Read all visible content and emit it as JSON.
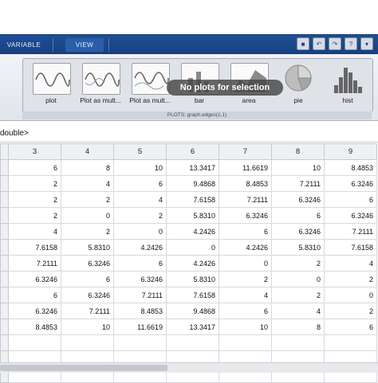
{
  "tabs": {
    "variable": "VARIABLE",
    "view": "VIEW"
  },
  "quick_access": [
    "save-icon",
    "undo-icon",
    "redo-icon",
    "help-icon",
    "menu-icon"
  ],
  "gallery": {
    "items": [
      {
        "label": "plot",
        "icon": "plot-icon"
      },
      {
        "label": "Plot as mult...",
        "icon": "plot-as-multiple-series-icon"
      },
      {
        "label": "Plot as mult...",
        "icon": "plot-as-multiple-series-icon"
      },
      {
        "label": "bar",
        "icon": "bar-icon"
      },
      {
        "label": "area",
        "icon": "area-icon"
      },
      {
        "label": "pie",
        "icon": "pie-icon"
      },
      {
        "label": "hist",
        "icon": "hist-icon"
      }
    ],
    "overlay": "No plots for selection",
    "caption": "PLOTS: graph.edges(1,1)"
  },
  "typebar": "double>",
  "table": {
    "columns": [
      "",
      "3",
      "4",
      "5",
      "6",
      "7",
      "8",
      "9"
    ],
    "rows": [
      [
        "",
        "6",
        "8",
        "10",
        "13.3417",
        "11.6619",
        "10",
        "8.4853"
      ],
      [
        "",
        "2",
        "4",
        "6",
        "9.4868",
        "8.4853",
        "7.2111",
        "6.3246"
      ],
      [
        "",
        "2",
        "2",
        "4",
        "7.6158",
        "7.2111",
        "6.3246",
        "6"
      ],
      [
        "",
        "2",
        "0",
        "2",
        "5.8310",
        "6.3246",
        "6",
        "6.3246"
      ],
      [
        "",
        "4",
        "2",
        "0",
        "4.2426",
        "6",
        "6.3246",
        "7.2111"
      ],
      [
        "",
        "7.6158",
        "5.8310",
        "4.2426",
        "0",
        "4.2426",
        "5.8310",
        "7.6158"
      ],
      [
        "",
        "7.2111",
        "6.3246",
        "6",
        "4.2426",
        "0",
        "2",
        "4"
      ],
      [
        "",
        "6.3246",
        "6",
        "6.3246",
        "5.8310",
        "2",
        "0",
        "2"
      ],
      [
        "",
        "6",
        "6.3246",
        "7.2111",
        "7.6158",
        "4",
        "2",
        "0"
      ],
      [
        "",
        "6.3246",
        "7.2111",
        "8.4853",
        "9.4868",
        "6",
        "4",
        "2"
      ],
      [
        "",
        "8.4853",
        "10",
        "11.6619",
        "13.3417",
        "10",
        "8",
        "6"
      ],
      [
        "",
        "",
        "",
        "",
        "",
        "",
        "",
        ""
      ],
      [
        "",
        "",
        "",
        "",
        "",
        "",
        "",
        ""
      ],
      [
        "",
        "",
        "",
        "",
        "",
        "",
        "",
        ""
      ]
    ]
  }
}
